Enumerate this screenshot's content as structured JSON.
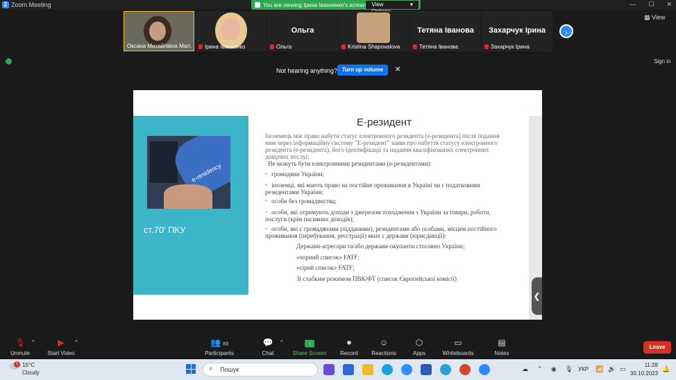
{
  "window": {
    "title": "Zoom Meeting",
    "controls": [
      "—",
      "☐",
      "✕"
    ]
  },
  "banner": {
    "text": "You are viewing Ірина Іваxненко's screen",
    "view_options": "View Options",
    "view_caret": "▾"
  },
  "gallery": {
    "tiles": [
      {
        "label": "Оксана Михайлівна Мал...",
        "big": "",
        "muted": false
      },
      {
        "label": "Ірина Іваxненко",
        "big": "",
        "muted": true
      },
      {
        "label": "Ольга",
        "big": "Ольга",
        "muted": true
      },
      {
        "label": "Kristina Shapovalova",
        "big": "",
        "muted": true
      },
      {
        "label": "Тетяна Іванова",
        "big": "Тетяна Іванова",
        "muted": true
      },
      {
        "label": "Захарчук Ірина",
        "big": "Захарчук Ірина",
        "muted": true
      }
    ],
    "next_glyph": "›"
  },
  "view_button": "View",
  "signin": "Sign in",
  "notice": {
    "text": "Not hearing anything?",
    "button": "Turn up volume",
    "close": "✕"
  },
  "slide": {
    "law_ref": "ст.70' ПКУ",
    "photo_text": "e-residency",
    "title": "Е-резидент",
    "intro": "Іноземець має право набути статус електронного резидента (е-резидента) після подання ним через інформаційну систему \"Е-резидент\" заяви про набуття статусу електронного резидента (е-резидента), його ідентифікації та надання кваліфікованих електронних довірчих послуг.",
    "subhead": "Не можуть бути електронними резидентами (е-резидентами):",
    "bullets": [
      "громадяни України;",
      "іноземці, які мають право на постійне проживання в Україні чи є податковими резидентами України;",
      "особи без громадянства;",
      "особи, які отримують доходи з джерелом походження з України за товари, роботи, послуги (крім пасивних доходів);",
      "особи, які є громадянами (підданими), резидентами або особами, місцем постійного проживання (перебування, реєстрації) яких є держави (юрисдикції):"
    ],
    "subitems": [
      "Держави-агресори та/або держави-окупанти стосовно України;",
      "«чорний список» FATF;",
      "«сірий список» FATF;",
      "Зі слабким режимом ПВК/ФТ (список Європейської комісії)"
    ],
    "handle_glyph": "❮"
  },
  "toolbar": {
    "unmute": "Unmute",
    "start_video": "Start Video",
    "participants": "Participants",
    "participants_count": "83",
    "chat": "Chat",
    "share_screen": "Share Screen",
    "record": "Record",
    "reactions": "Reactions",
    "apps": "Apps",
    "whiteboards": "Whiteboards",
    "notes": "Notes",
    "leave": "Leave",
    "caret": "^",
    "share_color": "#2fa84f"
  },
  "taskbar": {
    "weather_temp": "15°C",
    "weather_cond": "Cloudy",
    "weather_badge": "1",
    "search_placeholder": "Пошук",
    "lang": "УКР",
    "time": "11:28",
    "date": "30.10.2023"
  }
}
